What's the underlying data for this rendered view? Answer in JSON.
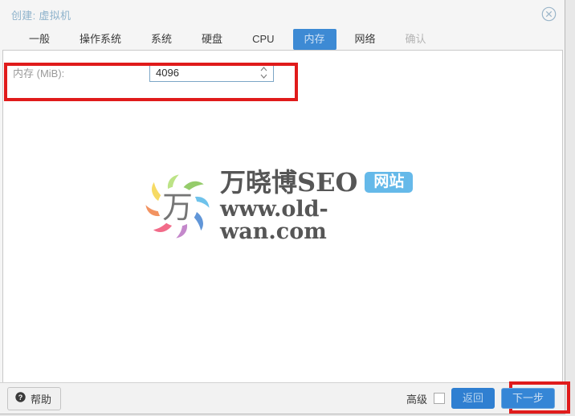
{
  "window": {
    "title": "创建: 虚拟机",
    "close_icon": "close-circle-icon"
  },
  "tabs": [
    {
      "label": "一般",
      "state": "normal"
    },
    {
      "label": "操作系统",
      "state": "normal"
    },
    {
      "label": "系统",
      "state": "normal"
    },
    {
      "label": "硬盘",
      "state": "normal"
    },
    {
      "label": "CPU",
      "state": "normal"
    },
    {
      "label": "内存",
      "state": "active"
    },
    {
      "label": "网络",
      "state": "normal"
    },
    {
      "label": "确认",
      "state": "disabled"
    }
  ],
  "form": {
    "memory": {
      "label": "内存 (MiB):",
      "value": "4096",
      "placeholder": "",
      "spinner_icon": "spinner-up-down-icon"
    }
  },
  "watermark": {
    "logo_icon": "wan-pinwheel-logo",
    "logo_glyph": "万",
    "brand": "万晓博SEO",
    "badge": "网站",
    "url": "www.old-wan.com"
  },
  "footer": {
    "help_label": "帮助",
    "help_icon": "question-circle-icon",
    "advanced_label": "高级",
    "advanced_checked": false,
    "back_label": "返回",
    "next_label": "下一步"
  },
  "annotations": {
    "highlight_color": "#e01b1b",
    "boxes": [
      {
        "name": "memory-field-highlight"
      },
      {
        "name": "next-button-highlight"
      }
    ]
  },
  "colors": {
    "accent_blue": "#3d8ad4",
    "title_blue": "#8fb3cc",
    "badge_blue": "#5ab4e8",
    "input_border": "#7ca6c6"
  }
}
